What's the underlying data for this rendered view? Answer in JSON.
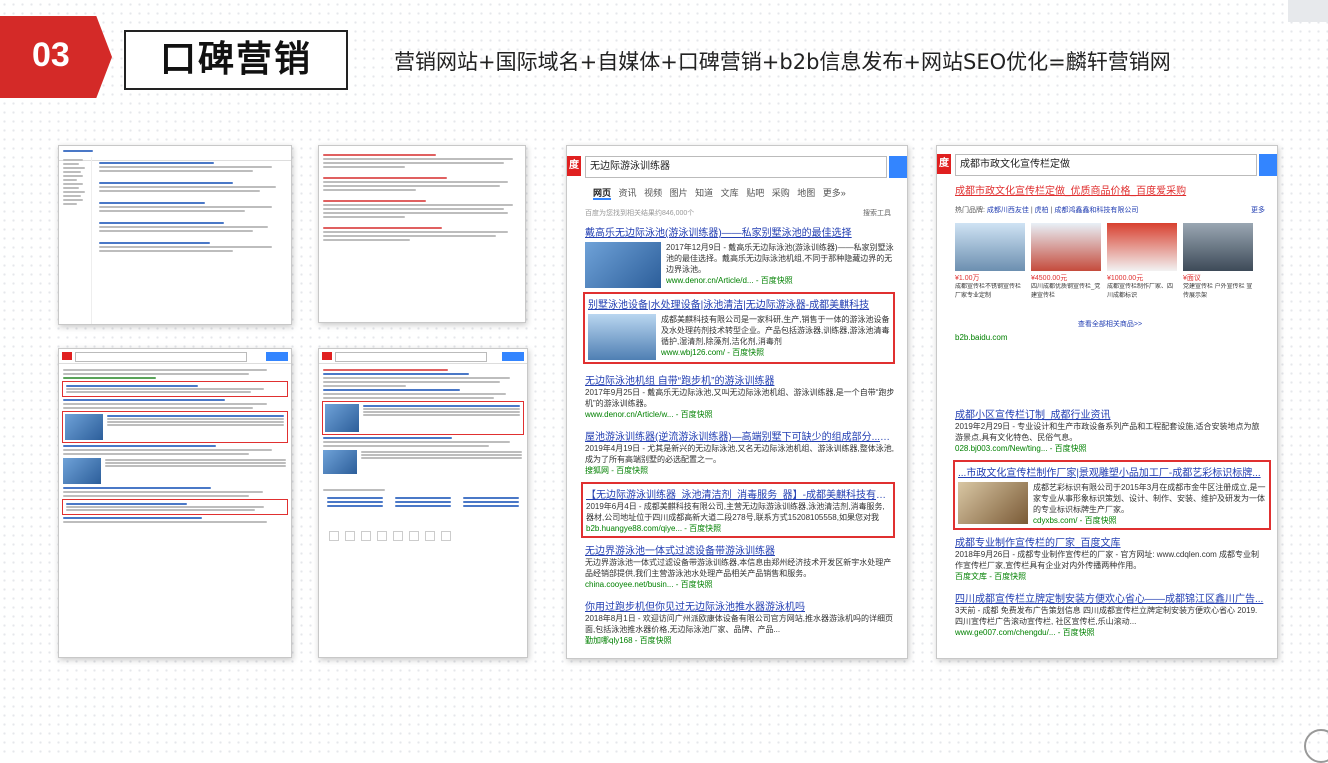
{
  "section": {
    "number": "03",
    "title": "口碑营销",
    "subtitle": "营销网站+国际域名+自媒体+口碑营销+b2b信息发布+网站SEO优化=麟轩营销网"
  },
  "colors": {
    "accent": "#d42a28"
  },
  "shot3": {
    "query": "无边际游泳训练器",
    "tabs": [
      "网页",
      "资讯",
      "视频",
      "图片",
      "知道",
      "文库",
      "贴吧",
      "采购",
      "地图",
      "更多»"
    ],
    "count": "百度为您找到相关结果约846,000个",
    "tool": "搜索工具",
    "results": [
      {
        "title": "戴高乐无边际泳池(游泳训练器)——私家别墅泳池的最佳选择",
        "desc": "2017年12月9日 - 戴高乐无边际泳池(游泳训练器)——私家别墅泳池的最佳选择。戴高乐无边际泳池机组,不同于那种隐藏边界的无边界泳池。",
        "url": "www.denor.cn/Article/d... - 百度快照"
      },
      {
        "title": "别墅泳池设备|水处理设备|泳池清洁|无边际游泳器-成都美麒科技",
        "desc": "成都美麒科技有限公司是一家科研,生产,销售于一体的游泳池设备及水处理药剂技术转型企业。产品包括游泳器,训练器,游泳池清毒循护,湿清剂,除藻剂,洁化剂,消毒剂",
        "url": "www.wbj126.com/ - 百度快照"
      },
      {
        "title": "无边际泳池机组 自带“跑步机”的游泳训练器",
        "desc": "2017年9月25日 - 戴高乐无边际泳池,又叫无边际泳池机组、游泳训练器,是一个自带“跑步机”的游泳训练器。",
        "url": "www.denor.cn/Article/w... - 百度快照"
      },
      {
        "title": "屋池游泳训练器(逆流游泳训练器)—高端别墅下可缺少的组成部分..._搜狐",
        "desc": "2019年4月19日 - 尤其是新兴的无边际泳池,又名无边际泳池机组、游泳训练器,整体泳池,成为了所有高端别墅的必选配置之一。",
        "url": "搜狐网 - 百度快照"
      },
      {
        "title": "【无边际游泳训练器_泳池清洁剂_消毒服务_器】-成都美麒科技有限...",
        "desc": "2019年6月4日 - 成都美麒科技有限公司,主营无边际游泳训练器,泳池清洁剂,消毒服务,器材,公司地址位于四川成都高新大道二段278号,联系方式15208105558,如果您对我",
        "url": "b2b.huangye88.com/qiye... - 百度快照"
      },
      {
        "title": "无边界游泳池一体式过滤设备带游泳训练器",
        "desc": "无边界游泳池一体式过滤设备带游泳训练器,本信息由郑州经济技术开发区新宇水处理产品经销部提供,我们主营游泳池水处理产品相关产品销售和服务。",
        "url": "china.cooyee.net/busin... - 百度快照"
      },
      {
        "title": "你用过跑步机但你见过无边际泳池推水器游泳机吗",
        "desc": "2018年8月1日 - 欢迎访问广州派欧康体设备有限公司官方网站,推水器游泳机吗的详细页面,包括泳池推水器价格,无边际泳池厂家、品牌、产品...",
        "url": "勤加哪qly168 - 百度快照"
      }
    ]
  },
  "shot4": {
    "query": "成都市政文化宣传栏定做",
    "ad_title": "成都市政文化宣传栏定做_优质商品价格_百度爱采购",
    "hot_label": "热门品牌:",
    "hot_brands": [
      "成都川西友佳",
      "虎柏",
      "成都鸿鑫鑫和科技有限公司"
    ],
    "more": "更多",
    "products": [
      {
        "price": "¥1.00万",
        "desc": "成都宣传栏不锈钢宣传栏厂家专业定制"
      },
      {
        "price": "¥4500.00元",
        "desc": "四川成都优质钢宣传栏_党建宣传栏"
      },
      {
        "price": "¥1000.00元",
        "desc": "成都宣传栏制作厂家、四川成都标识"
      },
      {
        "price": "¥面议",
        "desc": "党建宣传栏 户外宣传栏 宣传展示架"
      }
    ],
    "view_more": "查看全部相关商品>>",
    "source": "b2b.baidu.com",
    "results": [
      {
        "title": "成都小区宣传栏订制_成都行业资讯",
        "desc": "2019年2月29日 - 专业设计和生产市政设备系列产品和工程配套设施,适合安装地点为旅游景点,具有文化特色、民俗气息。",
        "url": "028.bj003.com/New/ting... - 百度快照"
      },
      {
        "title": "...市政文化宣传栏制作厂家|景观雕塑小品加工厂-成都艺彩标识标牌...",
        "desc": "成都艺彩标识有限公司于2015年3月在成都市金牛区注册成立,是一家专业从事形象标识策划、设计、制作、安装、维护及研发为一体的专业标识标牌生产厂家。",
        "url": "cdyxbs.com/ - 百度快照"
      },
      {
        "title": "成都专业制作宣传栏的厂家_百度文库",
        "desc": "2018年9月26日 - 成都专业制作宣传栏的厂家 - 官方网址: www.cdqlen.com 成都专业制作宣传栏厂家,宣传栏具有企业对内外传播两种作用。",
        "url": "百度文库 - 百度快照"
      },
      {
        "title": "四川成都宣传栏立牌定制安装方便欢心省心——成都锦江区鑫川广告...",
        "desc": "3天前 - 成都 免费发布广告策划信息 四川成都宣传栏立牌定制安装方便欢心省心 2019.四川宣传栏广告滚动宣传栏, 社区宣传栏,乐山滚动...",
        "url": "www.ge007.com/chengdu/... - 百度快照"
      }
    ]
  }
}
